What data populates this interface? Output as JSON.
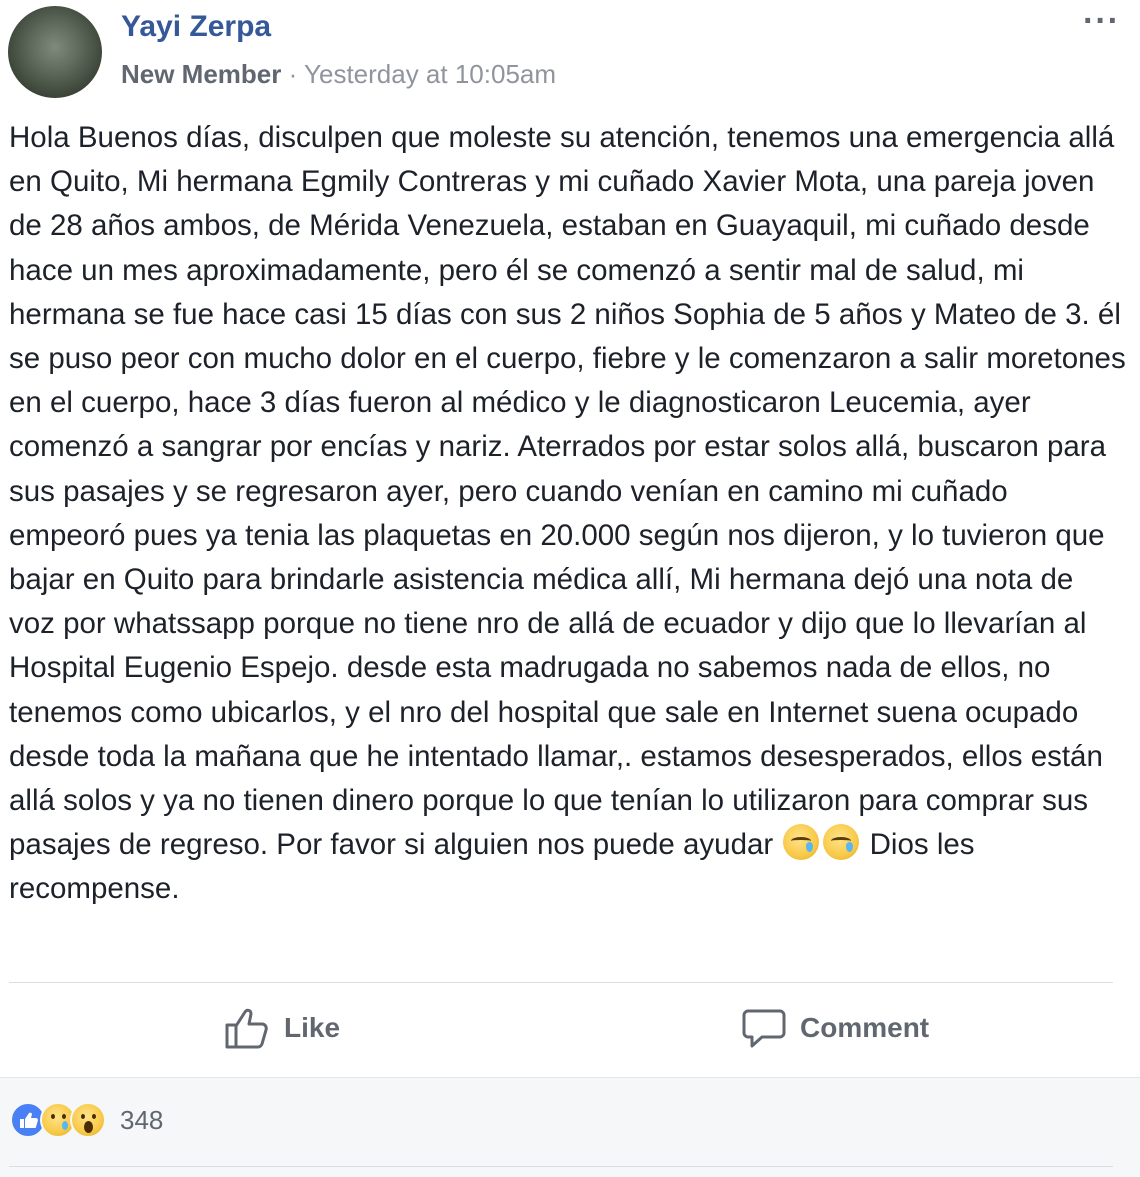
{
  "post": {
    "author": "Yayi Zerpa",
    "role": "New Member",
    "separator": " · ",
    "timestamp": "Yesterday at 10:05am",
    "more_icon": "more-horizontal-icon",
    "more_label": "···",
    "text_main": "Hola Buenos días, disculpen que moleste su atención, tenemos una emergencia allá en Quito, Mi hermana Egmily Contreras y mi cuñado Xavier Mota, una pareja joven de 28 años ambos, de Mérida Venezuela, estaban en Guayaquil, mi cuñado desde hace un mes aproximadamente, pero él se comenzó a sentir mal de salud, mi hermana se fue hace casi 15 días con sus 2 niños Sophia de 5 años y Mateo de 3. él se puso peor con mucho dolor en el cuerpo, fiebre y le comenzaron a salir moretones en el cuerpo, hace 3 días fueron al médico y le diagnosticaron Leucemia, ayer comenzó a sangrar por encías y nariz. Aterrados por estar solos allá, buscaron para sus pasajes y se regresaron ayer, pero cuando venían en camino mi cuñado empeoró pues ya tenia las plaquetas en 20.000 según nos dijeron, y lo tuvieron que bajar en Quito para brindarle asistencia médica allí, Mi hermana dejó una nota de voz por whatssapp porque no tiene nro de allá de ecuador y dijo que lo llevarían al Hospital Eugenio Espejo. desde esta madrugada no sabemos nada de ellos, no tenemos como ubicarlos, y el nro del hospital que sale en Internet suena ocupado desde toda la mañana que he intentado llamar,. estamos desesperados, ellos están allá solos y ya no tienen dinero porque lo que tenían lo utilizaron para comprar sus pasajes de regreso. Por favor si alguien nos puede ayudar",
    "text_end": "Dios les recompense.",
    "emoji_icons": [
      "crying-face-icon",
      "crying-face-icon"
    ]
  },
  "actions": {
    "like_label": "Like",
    "like_icon": "thumbs-up-icon",
    "comment_label": "Comment",
    "comment_icon": "comment-bubble-icon"
  },
  "reactions": {
    "icons": [
      "like-reaction-icon",
      "sad-reaction-icon",
      "wow-reaction-icon"
    ],
    "count": "348"
  },
  "colors": {
    "author": "#365899",
    "meta": "#90949c",
    "text": "#1d2129",
    "footer_bg": "#f6f7f9",
    "like_blue": "#4a80f5"
  }
}
